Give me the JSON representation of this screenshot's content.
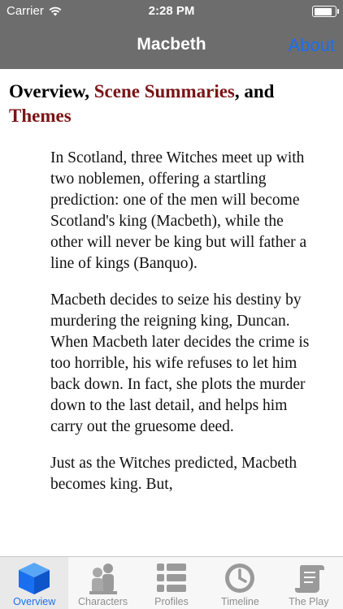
{
  "status_bar": {
    "carrier": "Carrier",
    "time": "2:28 PM",
    "battery_level": 0.9
  },
  "nav_bar": {
    "title": "Macbeth",
    "about_label": "About"
  },
  "content": {
    "heading_parts": {
      "part1": "Overview, ",
      "link1": "Scene Summaries",
      "part2": ", and ",
      "link2": "Themes"
    },
    "paragraphs": [
      "In Scotland, three Witches meet up with two noblemen, offering a startling prediction: one of the men will become Scotland's king (Macbeth), while the other will never be king but will father a line of kings (Banquo).",
      "Macbeth decides to seize his destiny by murdering the reigning king, Duncan. When Macbeth later decides the crime is too horrible, his wife refuses to let him back down. In fact, she plots the murder down to the last detail, and helps him carry out the gruesome deed.",
      "Just as the Witches predicted, Macbeth becomes king. But,"
    ]
  },
  "tabs": [
    {
      "label": "Overview",
      "icon": "cube-icon",
      "active": true
    },
    {
      "label": "Characters",
      "icon": "people-icon",
      "active": false
    },
    {
      "label": "Profiles",
      "icon": "list-icon",
      "active": false
    },
    {
      "label": "Timeline",
      "icon": "clock-icon",
      "active": false
    },
    {
      "label": "The Play",
      "icon": "scroll-icon",
      "active": false
    }
  ],
  "colors": {
    "nav_background": "#6d6d6d",
    "accent_blue": "#1a6ff0",
    "link_red": "#7a1416",
    "tab_inactive": "#8e8e8e"
  }
}
